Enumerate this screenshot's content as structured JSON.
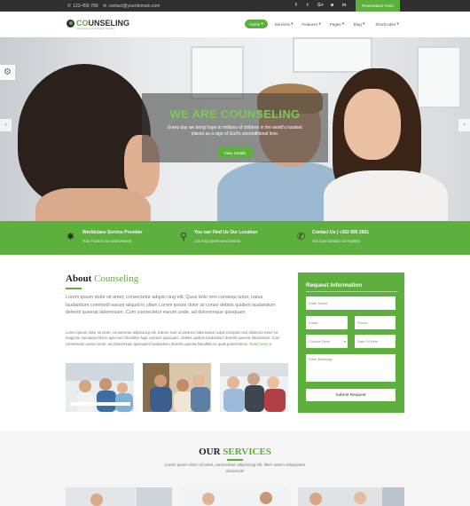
{
  "topbar": {
    "phone": "123-456-789",
    "email": "contact@yourdomain.com",
    "social": [
      "f",
      "t",
      "G+",
      "◙",
      "in"
    ],
    "reservation": "Reservation Form"
  },
  "header": {
    "logo_prefix": "CO",
    "logo_text": "UNSELING",
    "logo_tag": "Counseling & Psychotherapy Template",
    "nav": [
      "Home",
      "Services",
      "Features",
      "Pages",
      "Blog",
      "Shortcodes"
    ]
  },
  "hero": {
    "title": "WE ARE COUNSELING",
    "text": "Every day we bring hope to millions of children in the world's hardest places as a sign of God's unconditional love.",
    "button": "View Details"
  },
  "features": [
    {
      "title": "Worldclass Service Provider",
      "subtitle": "Your Trust is our achievement"
    },
    {
      "title": "You can Find Us Our Location",
      "subtitle": "121 King street west toronto"
    },
    {
      "title": "Contact Us | +262 695 2601",
      "subtitle": "You Can Contact Us Anytime"
    }
  ],
  "about": {
    "title": "About",
    "title_accent": "Counseling",
    "lead": "Lorem ipsum dolor sit amet, consectetur adipisi cing elit. Quos dolo rem consequ untur, natus laudantium commodi earum aliquid in ullam Lorem ipsum dolor sit conse debitis quidem laudantium deleniti queerat laboriosam. Cum consectetur earum unde, ad doloremque quisquam",
    "body": "Lorem ipsum dolor sit amet, consectetur adipisicing elit. Earum sunt ut dolorem laboriosam culpa excepturi sed distinctio esse! Ut magnam numquam libero quia vero blanditiis fugit corporis quisquam, debitis quidem laudantium deleniti queerat laboriosam. Cum consectetur earum unde, ad doloremque quisquam) laudantium deleniti quaerat blanditiis ex quas praesentium.",
    "read_more": "Read more"
  },
  "form": {
    "title": "Request Information",
    "name": "Enter Name",
    "email": "Email",
    "phone": "Phone",
    "service": "Choose Servi",
    "dob": "Date Of Birth",
    "message": "Enter Message",
    "submit": "Submit Request"
  },
  "services": {
    "title": "OUR",
    "title_accent": "SERVICES",
    "subtitle": "Lorem ipsum dolor sit amet, consectetur adipisicing elit. Illem autem voluptatem obcaecati!"
  },
  "colors": {
    "accent": "#5daf3e",
    "dark": "#2f2f2f"
  }
}
